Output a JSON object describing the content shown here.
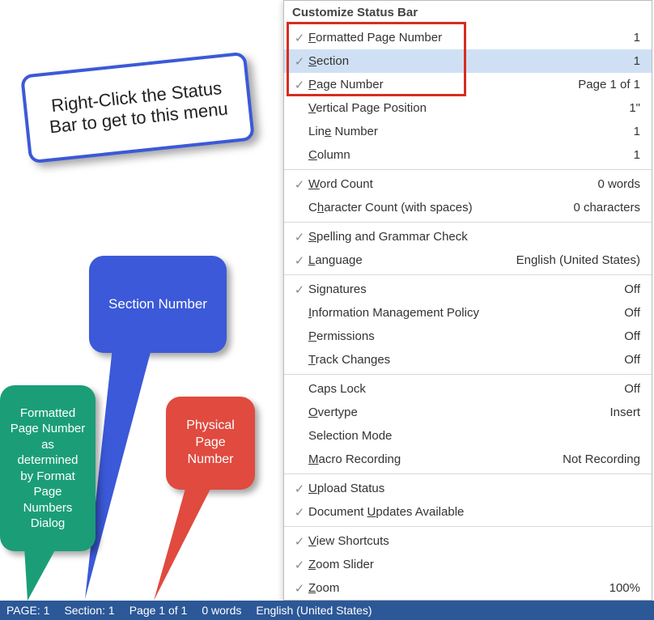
{
  "callouts": {
    "topleft": "Right-Click the Status Bar to get to this menu",
    "blue": "Section Number",
    "green": "Formatted Page Number as determined by Format Page Numbers Dialog",
    "red": "Physical Page Number"
  },
  "menu": {
    "title": "Customize Status Bar",
    "groups": [
      [
        {
          "checked": true,
          "label": "Formatted Page Number",
          "accel": "F",
          "value": "1",
          "hover": false
        },
        {
          "checked": true,
          "label": "Section",
          "accel": "S",
          "value": "1",
          "hover": true
        },
        {
          "checked": true,
          "label": "Page Number",
          "accel": "P",
          "value": "Page 1 of 1",
          "hover": false
        },
        {
          "checked": false,
          "label": "Vertical Page Position",
          "accel": "V",
          "value": "1\"",
          "hover": false
        },
        {
          "checked": false,
          "label": "Line Number",
          "accel": "e",
          "value": "1",
          "hover": false
        },
        {
          "checked": false,
          "label": "Column",
          "accel": "C",
          "value": "1",
          "hover": false
        }
      ],
      [
        {
          "checked": true,
          "label": "Word Count",
          "accel": "W",
          "value": "0 words",
          "hover": false
        },
        {
          "checked": false,
          "label": "Character Count (with spaces)",
          "accel": "h",
          "value": "0 characters",
          "hover": false
        }
      ],
      [
        {
          "checked": true,
          "label": "Spelling and Grammar Check",
          "accel": "S",
          "value": "",
          "hover": false
        },
        {
          "checked": true,
          "label": "Language",
          "accel": "L",
          "value": "English (United States)",
          "hover": false
        }
      ],
      [
        {
          "checked": true,
          "label": "Signatures",
          "accel": "g",
          "value": "Off",
          "hover": false
        },
        {
          "checked": false,
          "label": "Information Management Policy",
          "accel": "I",
          "value": "Off",
          "hover": false
        },
        {
          "checked": false,
          "label": "Permissions",
          "accel": "P",
          "value": "Off",
          "hover": false
        },
        {
          "checked": false,
          "label": "Track Changes",
          "accel": "T",
          "value": "Off",
          "hover": false
        }
      ],
      [
        {
          "checked": false,
          "label": "Caps Lock",
          "accel": "",
          "value": "Off",
          "hover": false
        },
        {
          "checked": false,
          "label": "Overtype",
          "accel": "O",
          "value": "Insert",
          "hover": false
        },
        {
          "checked": false,
          "label": "Selection Mode",
          "accel": "",
          "value": "",
          "hover": false
        },
        {
          "checked": false,
          "label": "Macro Recording",
          "accel": "M",
          "value": "Not Recording",
          "hover": false
        }
      ],
      [
        {
          "checked": true,
          "label": "Upload Status",
          "accel": "U",
          "value": "",
          "hover": false
        },
        {
          "checked": true,
          "label": "Document Updates Available",
          "accel": "U",
          "value": "",
          "hover": false
        }
      ],
      [
        {
          "checked": true,
          "label": "View Shortcuts",
          "accel": "V",
          "value": "",
          "hover": false
        },
        {
          "checked": true,
          "label": "Zoom Slider",
          "accel": "Z",
          "value": "",
          "hover": false
        },
        {
          "checked": true,
          "label": "Zoom",
          "accel": "Z",
          "value": "100%",
          "hover": false
        }
      ]
    ]
  },
  "statusbar": {
    "page": "PAGE: 1",
    "section": "Section: 1",
    "pageof": "Page 1 of 1",
    "words": "0 words",
    "lang": "English (United States)"
  }
}
